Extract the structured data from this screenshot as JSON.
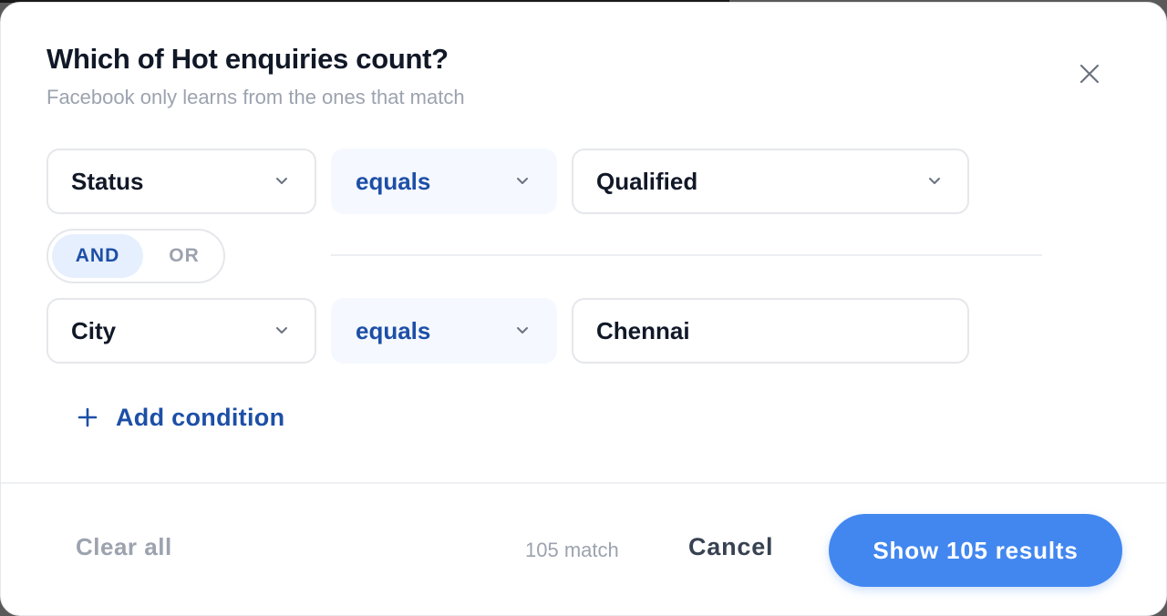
{
  "dialog": {
    "title": "Which of Hot enquiries count?",
    "subtitle": "Facebook only learns from the ones that match"
  },
  "conditions": [
    {
      "field": "Status",
      "operator": "equals",
      "value": "Qualified",
      "value_type": "select"
    },
    {
      "field": "City",
      "operator": "equals",
      "value": "Chennai",
      "value_type": "text"
    }
  ],
  "logic": {
    "and_label": "AND",
    "or_label": "OR",
    "selected": "AND"
  },
  "add_condition_label": "Add condition",
  "footer": {
    "clear_all_label": "Clear all",
    "match_text": "105 match",
    "cancel_label": "Cancel",
    "primary_label": "Show 105 results"
  },
  "icons": {
    "close": "close-icon",
    "chevron": "chevron-down-icon",
    "add": "plus-icon"
  },
  "colors": {
    "accent": "#4287f0",
    "link": "#1d4fa7",
    "muted": "#9ca3af"
  }
}
